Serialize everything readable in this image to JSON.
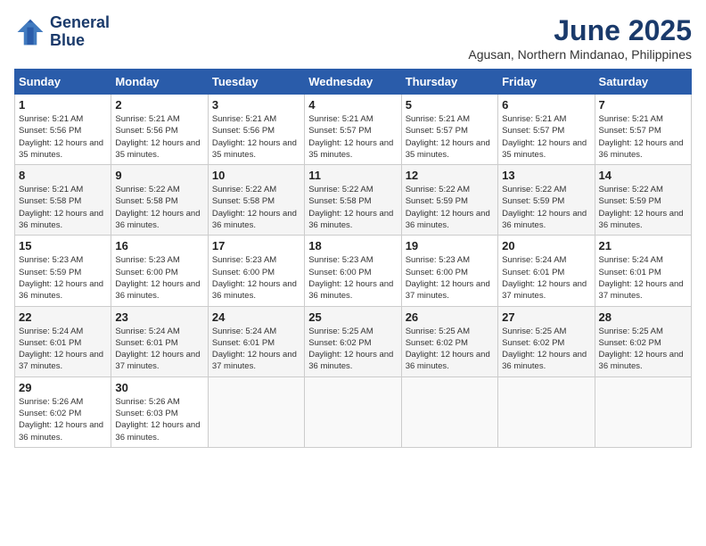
{
  "header": {
    "logo_line1": "General",
    "logo_line2": "Blue",
    "month": "June 2025",
    "location": "Agusan, Northern Mindanao, Philippines"
  },
  "weekdays": [
    "Sunday",
    "Monday",
    "Tuesday",
    "Wednesday",
    "Thursday",
    "Friday",
    "Saturday"
  ],
  "weeks": [
    [
      {
        "day": "1",
        "sunrise": "5:21 AM",
        "sunset": "5:56 PM",
        "daylight": "12 hours and 35 minutes."
      },
      {
        "day": "2",
        "sunrise": "5:21 AM",
        "sunset": "5:56 PM",
        "daylight": "12 hours and 35 minutes."
      },
      {
        "day": "3",
        "sunrise": "5:21 AM",
        "sunset": "5:56 PM",
        "daylight": "12 hours and 35 minutes."
      },
      {
        "day": "4",
        "sunrise": "5:21 AM",
        "sunset": "5:57 PM",
        "daylight": "12 hours and 35 minutes."
      },
      {
        "day": "5",
        "sunrise": "5:21 AM",
        "sunset": "5:57 PM",
        "daylight": "12 hours and 35 minutes."
      },
      {
        "day": "6",
        "sunrise": "5:21 AM",
        "sunset": "5:57 PM",
        "daylight": "12 hours and 35 minutes."
      },
      {
        "day": "7",
        "sunrise": "5:21 AM",
        "sunset": "5:57 PM",
        "daylight": "12 hours and 36 minutes."
      }
    ],
    [
      {
        "day": "8",
        "sunrise": "5:21 AM",
        "sunset": "5:58 PM",
        "daylight": "12 hours and 36 minutes."
      },
      {
        "day": "9",
        "sunrise": "5:22 AM",
        "sunset": "5:58 PM",
        "daylight": "12 hours and 36 minutes."
      },
      {
        "day": "10",
        "sunrise": "5:22 AM",
        "sunset": "5:58 PM",
        "daylight": "12 hours and 36 minutes."
      },
      {
        "day": "11",
        "sunrise": "5:22 AM",
        "sunset": "5:58 PM",
        "daylight": "12 hours and 36 minutes."
      },
      {
        "day": "12",
        "sunrise": "5:22 AM",
        "sunset": "5:59 PM",
        "daylight": "12 hours and 36 minutes."
      },
      {
        "day": "13",
        "sunrise": "5:22 AM",
        "sunset": "5:59 PM",
        "daylight": "12 hours and 36 minutes."
      },
      {
        "day": "14",
        "sunrise": "5:22 AM",
        "sunset": "5:59 PM",
        "daylight": "12 hours and 36 minutes."
      }
    ],
    [
      {
        "day": "15",
        "sunrise": "5:23 AM",
        "sunset": "5:59 PM",
        "daylight": "12 hours and 36 minutes."
      },
      {
        "day": "16",
        "sunrise": "5:23 AM",
        "sunset": "6:00 PM",
        "daylight": "12 hours and 36 minutes."
      },
      {
        "day": "17",
        "sunrise": "5:23 AM",
        "sunset": "6:00 PM",
        "daylight": "12 hours and 36 minutes."
      },
      {
        "day": "18",
        "sunrise": "5:23 AM",
        "sunset": "6:00 PM",
        "daylight": "12 hours and 36 minutes."
      },
      {
        "day": "19",
        "sunrise": "5:23 AM",
        "sunset": "6:00 PM",
        "daylight": "12 hours and 37 minutes."
      },
      {
        "day": "20",
        "sunrise": "5:24 AM",
        "sunset": "6:01 PM",
        "daylight": "12 hours and 37 minutes."
      },
      {
        "day": "21",
        "sunrise": "5:24 AM",
        "sunset": "6:01 PM",
        "daylight": "12 hours and 37 minutes."
      }
    ],
    [
      {
        "day": "22",
        "sunrise": "5:24 AM",
        "sunset": "6:01 PM",
        "daylight": "12 hours and 37 minutes."
      },
      {
        "day": "23",
        "sunrise": "5:24 AM",
        "sunset": "6:01 PM",
        "daylight": "12 hours and 37 minutes."
      },
      {
        "day": "24",
        "sunrise": "5:24 AM",
        "sunset": "6:01 PM",
        "daylight": "12 hours and 37 minutes."
      },
      {
        "day": "25",
        "sunrise": "5:25 AM",
        "sunset": "6:02 PM",
        "daylight": "12 hours and 36 minutes."
      },
      {
        "day": "26",
        "sunrise": "5:25 AM",
        "sunset": "6:02 PM",
        "daylight": "12 hours and 36 minutes."
      },
      {
        "day": "27",
        "sunrise": "5:25 AM",
        "sunset": "6:02 PM",
        "daylight": "12 hours and 36 minutes."
      },
      {
        "day": "28",
        "sunrise": "5:25 AM",
        "sunset": "6:02 PM",
        "daylight": "12 hours and 36 minutes."
      }
    ],
    [
      {
        "day": "29",
        "sunrise": "5:26 AM",
        "sunset": "6:02 PM",
        "daylight": "12 hours and 36 minutes."
      },
      {
        "day": "30",
        "sunrise": "5:26 AM",
        "sunset": "6:03 PM",
        "daylight": "12 hours and 36 minutes."
      },
      null,
      null,
      null,
      null,
      null
    ]
  ]
}
